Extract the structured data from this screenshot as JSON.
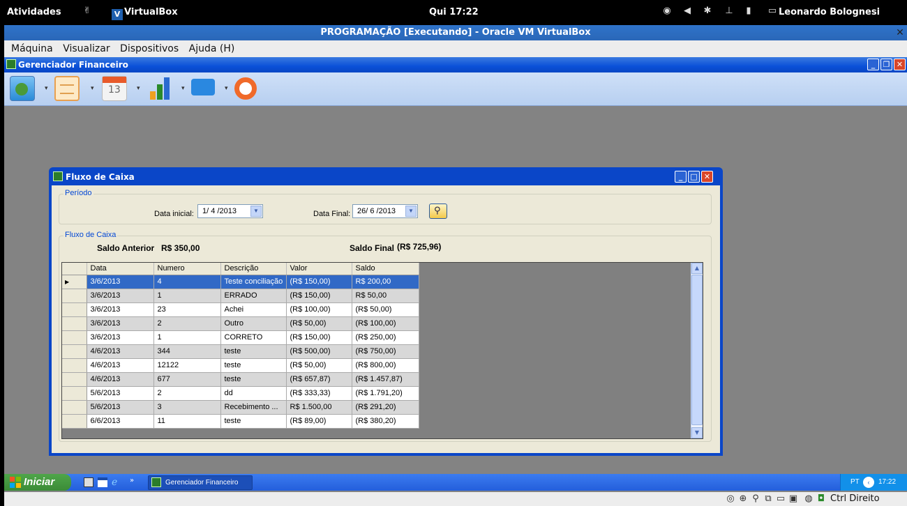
{
  "topbar": {
    "activities": "Atividades",
    "app_name": "VirtualBox",
    "clock": "Qui 17:22",
    "user": "Leonardo Bolognesi"
  },
  "vbox": {
    "title": "PROGRAMAÇÃO [Executando] - Oracle VM VirtualBox",
    "menu": [
      "Máquina",
      "Visualizar",
      "Dispositivos",
      "Ajuda (H)"
    ],
    "host_key": "Ctrl Direito"
  },
  "app": {
    "title": "Gerenciador Financeiro",
    "calendar_day": "13"
  },
  "dialog": {
    "title": "Fluxo de Caixa",
    "periodo_label": "Período",
    "data_inicial_label": "Data inicial:",
    "data_inicial_value": "1/ 4 /2013",
    "data_final_label": "Data Final:",
    "data_final_value": "26/ 6 /2013",
    "fluxo_label": "Fluxo de Caixa",
    "saldo_anterior_label": "Saldo Anterior",
    "saldo_anterior_value": "R$ 350,00",
    "saldo_final_label": "Saldo Final",
    "saldo_final_value": "(R$ 725,96)"
  },
  "grid": {
    "columns": [
      "Data",
      "Numero",
      "Descrição",
      "Valor",
      "Saldo"
    ],
    "rows": [
      [
        "3/6/2013",
        "4",
        "Teste conciliação",
        "(R$ 150,00)",
        "R$ 200,00"
      ],
      [
        "3/6/2013",
        "1",
        "ERRADO",
        "(R$ 150,00)",
        "R$ 50,00"
      ],
      [
        "3/6/2013",
        "23",
        "Achei",
        "(R$ 100,00)",
        "(R$ 50,00)"
      ],
      [
        "3/6/2013",
        "2",
        "Outro",
        "(R$ 50,00)",
        "(R$ 100,00)"
      ],
      [
        "3/6/2013",
        "1",
        "CORRETO",
        "(R$ 150,00)",
        "(R$ 250,00)"
      ],
      [
        "4/6/2013",
        "344",
        "teste",
        "(R$ 500,00)",
        "(R$ 750,00)"
      ],
      [
        "4/6/2013",
        "12122",
        "teste",
        "(R$ 50,00)",
        "(R$ 800,00)"
      ],
      [
        "4/6/2013",
        "677",
        "teste",
        "(R$ 657,87)",
        "(R$ 1.457,87)"
      ],
      [
        "5/6/2013",
        "2",
        "dd",
        "(R$ 333,33)",
        "(R$ 1.791,20)"
      ],
      [
        "5/6/2013",
        "3",
        "Recebimento ...",
        "R$ 1.500,00",
        "(R$ 291,20)"
      ],
      [
        "6/6/2013",
        "11",
        "teste",
        "(R$ 89,00)",
        "(R$ 380,20)"
      ]
    ],
    "selected_row": 0
  },
  "taskbar": {
    "start": "Iniciar",
    "task": "Gerenciador Financeiro",
    "lang": "PT",
    "clock": "17:22"
  }
}
